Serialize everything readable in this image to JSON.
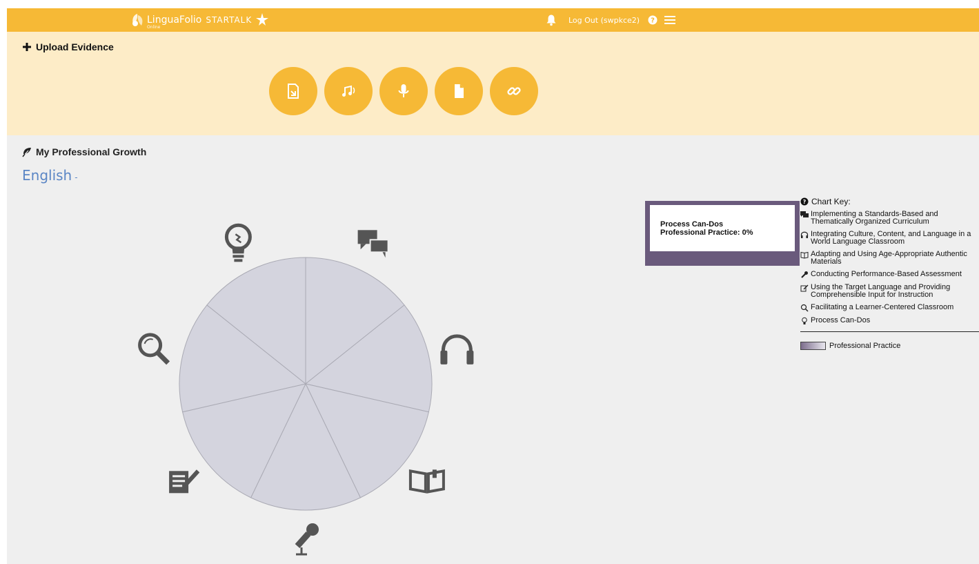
{
  "header": {
    "logo_text": "LinguaFolio",
    "logo_sub": "Online",
    "brand": "STARTALK",
    "logout": "Log Out (swpkce2)"
  },
  "upload": {
    "title": "Upload Evidence",
    "buttons": [
      "upload-file",
      "upload-audio",
      "record-audio",
      "upload-document",
      "add-link"
    ]
  },
  "growth": {
    "title": "My Professional Growth",
    "language": "English",
    "caret": "-"
  },
  "tooltip": {
    "line1": "Process Can-Dos",
    "line2": "Professional Practice: 0%"
  },
  "chart_key": {
    "title": "Chart Key:",
    "items": [
      "Implementing a Standards-Based and Thematically Organized Curriculum",
      "Integrating Culture, Content, and Language in a World Language Classroom",
      "Adapting and Using Age-Appropriate Authentic Materials",
      "Conducting Performance-Based Assessment",
      "Using the Target Language and Providing Comprehensible Input for Instruction",
      "Facilitating a Learner-Centered Classroom",
      "Process Can-Dos"
    ],
    "legend": "Professional Practice"
  },
  "chart_data": {
    "type": "pie",
    "categories": [
      "Implementing a Standards-Based and Thematically Organized Curriculum",
      "Integrating Culture, Content, and Language in a World Language Classroom",
      "Adapting and Using Age-Appropriate Authentic Materials",
      "Conducting Performance-Based Assessment",
      "Using the Target Language and Providing Comprehensible Input for Instruction",
      "Facilitating a Learner-Centered Classroom",
      "Process Can-Dos"
    ],
    "segment_icons": [
      "comments-icon",
      "headphones-icon",
      "book-icon",
      "microphone-icon",
      "edit-icon",
      "search-icon",
      "lightbulb-icon"
    ],
    "values": [
      0,
      0,
      0,
      0,
      0,
      0,
      0
    ],
    "unit": "%",
    "fill": "#d4d4de",
    "colors": {
      "accent": "#f6b936",
      "upload_bg": "#fdecc7",
      "tooltip_border": "#6a5a7c",
      "link": "#5b86c5"
    }
  }
}
